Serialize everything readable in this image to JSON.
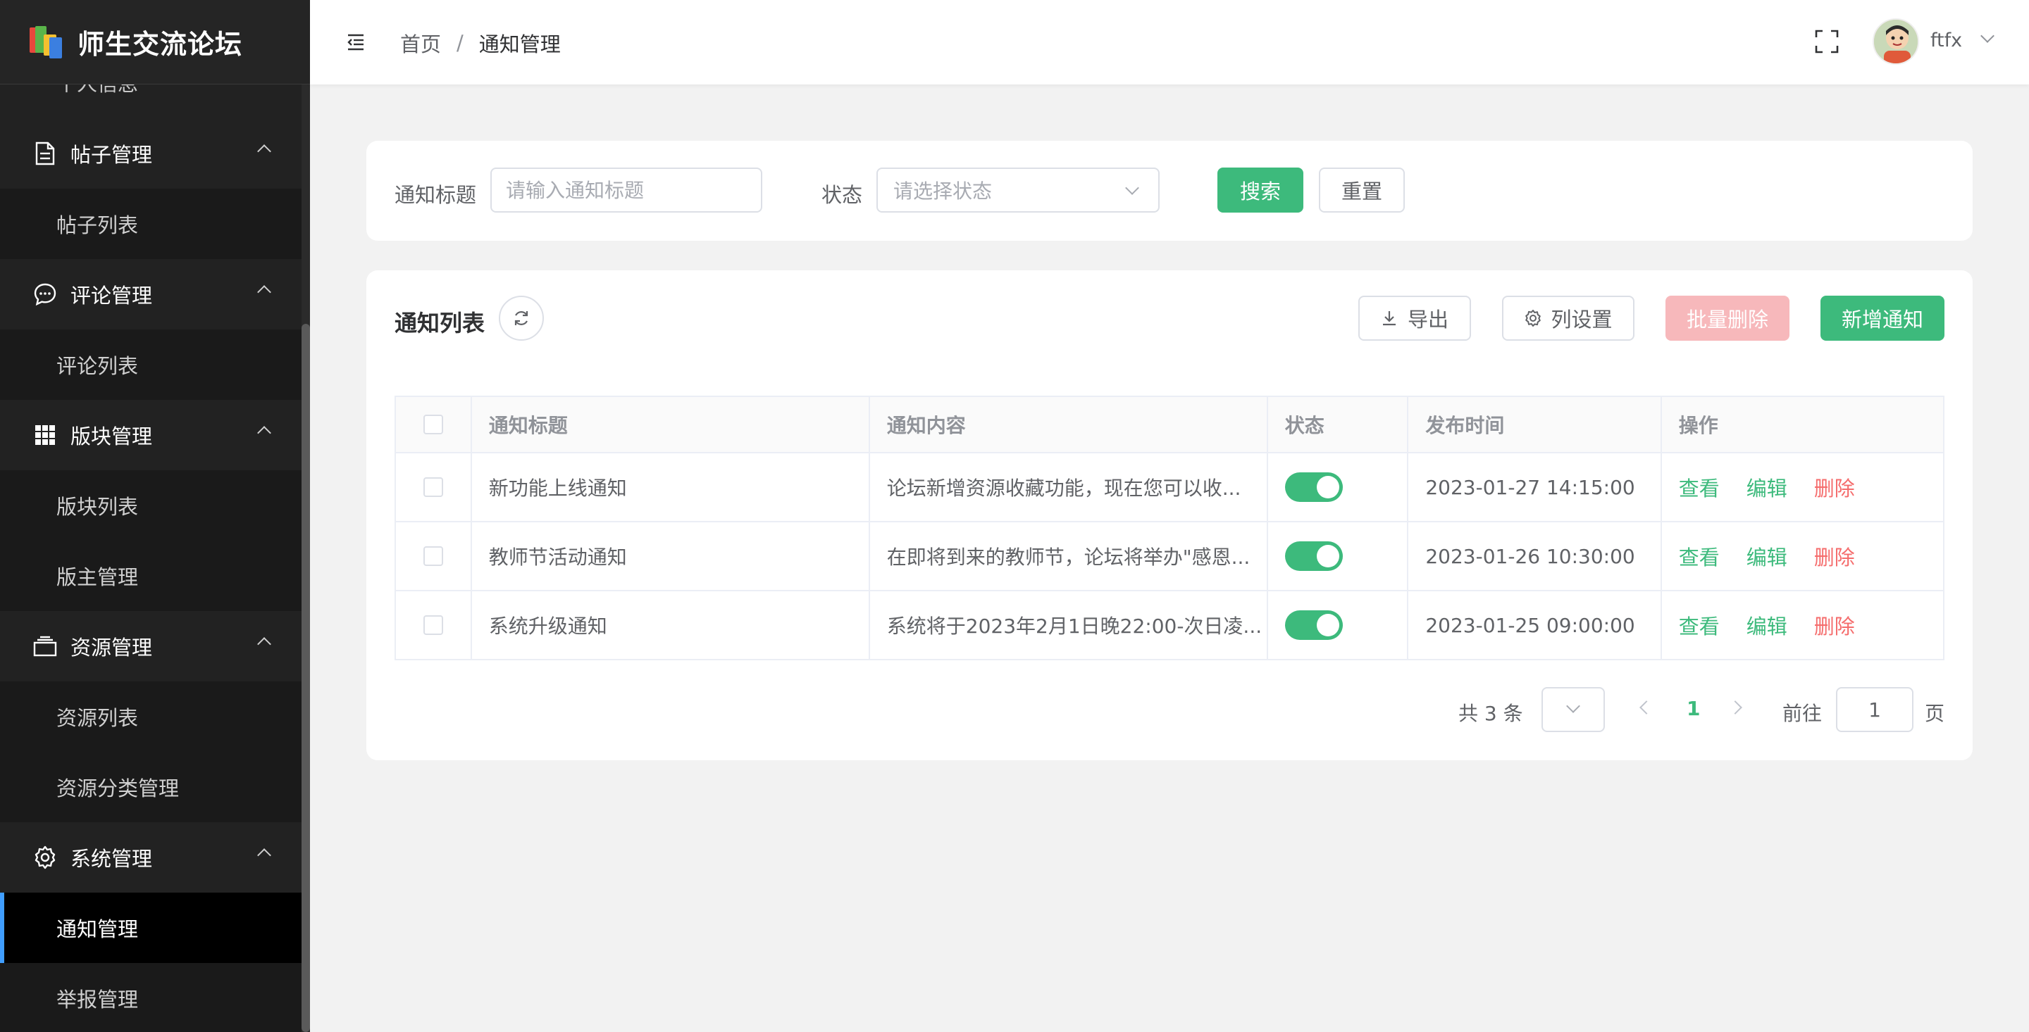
{
  "app": {
    "title": "师生交流论坛"
  },
  "sidebar": {
    "partial_item": "个人信息",
    "groups": [
      {
        "label": "帖子管理",
        "icon": "document-icon",
        "items": [
          "帖子列表"
        ]
      },
      {
        "label": "评论管理",
        "icon": "chat-icon",
        "items": [
          "评论列表"
        ]
      },
      {
        "label": "版块管理",
        "icon": "grid-icon",
        "items": [
          "版块列表",
          "版主管理"
        ]
      },
      {
        "label": "资源管理",
        "icon": "box-icon",
        "items": [
          "资源列表",
          "资源分类管理"
        ]
      },
      {
        "label": "系统管理",
        "icon": "gear-icon",
        "items": [
          "通知管理",
          "举报管理"
        ]
      }
    ],
    "active_item": "通知管理"
  },
  "header": {
    "breadcrumb": [
      "首页",
      "通知管理"
    ],
    "username": "ftfx"
  },
  "search": {
    "title_label": "通知标题",
    "title_placeholder": "请输入通知标题",
    "status_label": "状态",
    "status_placeholder": "请选择状态",
    "search_button": "搜索",
    "reset_button": "重置"
  },
  "list": {
    "title": "通知列表",
    "export_button": "导出",
    "columns_button": "列设置",
    "batch_delete_button": "批量删除",
    "add_button": "新增通知",
    "columns": [
      "通知标题",
      "通知内容",
      "状态",
      "发布时间",
      "操作"
    ],
    "rows": [
      {
        "title": "新功能上线通知",
        "content": "论坛新增资源收藏功能，现在您可以收...",
        "status": true,
        "time": "2023-01-27 14:15:00"
      },
      {
        "title": "教师节活动通知",
        "content": "在即将到来的教师节，论坛将举办\"感恩...",
        "status": true,
        "time": "2023-01-26 10:30:00"
      },
      {
        "title": "系统升级通知",
        "content": "系统将于2023年2月1日晚22:00-次日凌...",
        "status": true,
        "time": "2023-01-25 09:00:00"
      }
    ],
    "actions": {
      "view": "查看",
      "edit": "编辑",
      "delete": "删除"
    }
  },
  "pagination": {
    "total_text": "共 3 条",
    "current_page": "1",
    "goto_label": "前往",
    "goto_value": "1",
    "page_suffix": "页"
  },
  "colors": {
    "primary": "#3dba7c",
    "danger": "#f56c6c",
    "sidebar_bg": "#222222",
    "active_indicator": "#409eff"
  }
}
